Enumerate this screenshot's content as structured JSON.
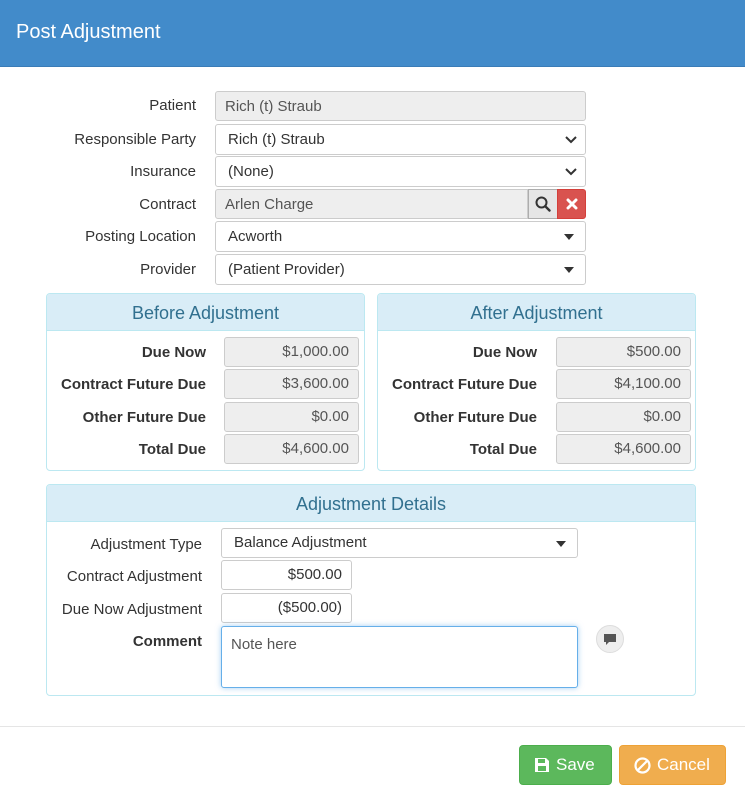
{
  "modal": {
    "title": "Post Adjustment"
  },
  "form": {
    "patient": {
      "label": "Patient",
      "value": "Rich (t) Straub"
    },
    "responsible_party": {
      "label": "Responsible Party",
      "value": "Rich (t) Straub"
    },
    "insurance": {
      "label": "Insurance",
      "value": "(None)"
    },
    "contract": {
      "label": "Contract",
      "value": "Arlen Charge"
    },
    "posting_location": {
      "label": "Posting Location",
      "value": "Acworth"
    },
    "provider": {
      "label": "Provider",
      "value": "(Patient Provider)"
    }
  },
  "before": {
    "title": "Before Adjustment",
    "rows": [
      {
        "label": "Due Now",
        "value": "$1,000.00"
      },
      {
        "label": "Contract Future Due",
        "value": "$3,600.00"
      },
      {
        "label": "Other Future Due",
        "value": "$0.00"
      },
      {
        "label": "Total Due",
        "value": "$4,600.00"
      }
    ]
  },
  "after": {
    "title": "After Adjustment",
    "rows": [
      {
        "label": "Due Now",
        "value": "$500.00"
      },
      {
        "label": "Contract Future Due",
        "value": "$4,100.00"
      },
      {
        "label": "Other Future Due",
        "value": "$0.00"
      },
      {
        "label": "Total Due",
        "value": "$4,600.00"
      }
    ]
  },
  "details": {
    "title": "Adjustment Details",
    "adjustment_type": {
      "label": "Adjustment Type",
      "value": "Balance Adjustment"
    },
    "contract_adjustment": {
      "label": "Contract Adjustment",
      "value": "$500.00"
    },
    "due_now_adjustment": {
      "label": "Due Now Adjustment",
      "value": "($500.00)"
    },
    "comment": {
      "label": "Comment",
      "value": "Note here"
    }
  },
  "footer": {
    "save_label": "Save",
    "cancel_label": "Cancel"
  },
  "colors": {
    "header": "#428bca",
    "panel_head": "#d9edf7",
    "panel_text": "#31708f",
    "save": "#5cb85c",
    "cancel": "#f0ad4e",
    "remove": "#d9534f"
  },
  "icons": {
    "search": "search-icon",
    "remove": "close-icon",
    "comment": "comment-icon",
    "save": "floppy-disk-icon",
    "cancel": "ban-icon",
    "dropdown": "chevron-down-icon",
    "select": "caret-down-icon"
  }
}
